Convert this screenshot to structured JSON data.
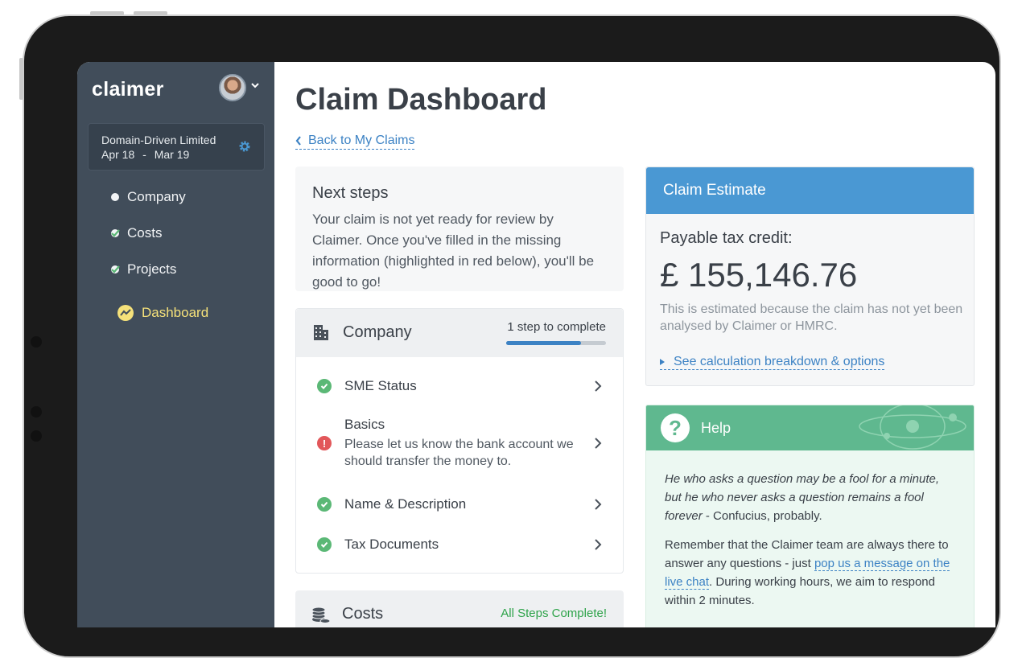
{
  "sidebar": {
    "logo": "claimer",
    "account": {
      "name": "Domain-Driven Limited",
      "period_start": "Apr 18",
      "period_sep": "-",
      "period_end": "Mar 19"
    },
    "nav": [
      {
        "label": "Company",
        "state": "incomplete"
      },
      {
        "label": "Costs",
        "state": "complete"
      },
      {
        "label": "Projects",
        "state": "complete"
      }
    ],
    "dashboard_label": "Dashboard"
  },
  "main": {
    "title": "Claim Dashboard",
    "back_link": "Back to My Claims",
    "next_steps": {
      "heading": "Next steps",
      "body": "Your claim is not yet ready for review by Claimer. Once you've filled in the missing information (highlighted in red below), you'll be good to go!"
    },
    "company_section": {
      "title": "Company",
      "steps_text": "1 step to complete",
      "progress": 0.75,
      "items": [
        {
          "label": "SME Status",
          "status": "ok"
        },
        {
          "label": "Basics",
          "status": "error",
          "detail": "Please let us know the bank account we should transfer the money to."
        },
        {
          "label": "Name & Description",
          "status": "ok"
        },
        {
          "label": "Tax Documents",
          "status": "ok"
        }
      ]
    },
    "costs_section": {
      "title": "Costs",
      "status_text": "All Steps Complete!"
    }
  },
  "estimate": {
    "header": "Claim Estimate",
    "label": "Payable tax credit:",
    "amount": "£ 155,146.76",
    "note": "This is estimated because the claim has not yet been analysed by Claimer or HMRC.",
    "link": "See calculation breakdown & options"
  },
  "help": {
    "header": "Help",
    "quote": "He who asks a question may be a fool for a minute, but he who never asks a question remains a fool forever",
    "quote_attr": "- Confucius, probably.",
    "remember_pre": "Remember that the Claimer team are always there to answer any questions - just ",
    "remember_link": "pop us a message on the live chat",
    "remember_post": ". During working hours, we aim to respond within 2 minutes."
  },
  "colors": {
    "sidebar": "#414d5a",
    "accent_blue": "#4a98d3",
    "help_green": "#5fb88f",
    "ok_green": "#5bb876",
    "error_red": "#e2575a",
    "dashboard_yellow": "#f5e17a"
  }
}
